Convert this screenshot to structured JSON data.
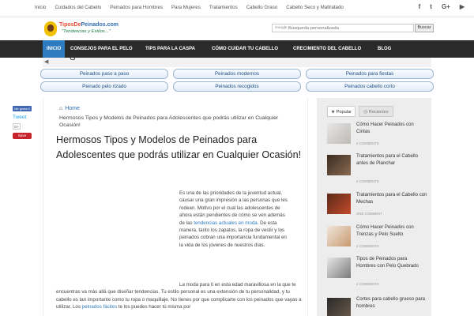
{
  "topbar": {
    "links": [
      "Inicio",
      "Cuidados del Cabello",
      "Peinados para Hombres",
      "Para Mujeres",
      "Tratamientos",
      "Cabello Graso",
      "Cabello Seco y Maltratado"
    ],
    "social": [
      "facebook-icon",
      "twitter-icon",
      "google-plus-icon",
      "youtube-icon"
    ]
  },
  "header": {
    "logo_title_a": "TiposDe",
    "logo_title_b": "Peinados.com",
    "logo_sub": "\"Tendencias y Estilos...\"",
    "search_google": "Google",
    "search_placeholder": "Búsqueda personalizada",
    "search_button": "Buscar"
  },
  "nav": {
    "items": [
      "Inicio",
      "Consejos para el pelo",
      "Tips para la caspa",
      "Cómo cuidar tu cabello",
      "Crecimiento del cabello",
      "Blog"
    ]
  },
  "pills": [
    "Peinados paso a paso",
    "Peinados modernos",
    "Peinados para fiestas",
    "Peinado pelo rizado",
    "Peinados recogidos",
    "Peinados cabello corto"
  ],
  "share": {
    "fb": "Me gusta 0",
    "tw": "Tweet",
    "gp": "G+",
    "save": "Save"
  },
  "article": {
    "crumb_home": "Home",
    "crumb_current": "Hermosos Tipos y Modelos de Peinados para Adolescentes que podrás utilizar en Cualquier Ocasión!",
    "title": "Hermosos Tipos y Modelos de Peinados para Adolescentes que podrás utilizar en Cualquier Ocasión!",
    "p1_a": "Es una de las prioridades de la juventud actual, causar una gran impresión a las personas que les rodean. Motivo por el cual las adolescentes de ahora están pendientes de cómo se ven además de las ",
    "p1_link": "tendencias actuales en moda",
    "p1_b": ". De esta manera, tanto los zapatos, la ropa de vestir y los peinados cobran una importancia fundamental en la vida de los jóvenes de nuestros días.",
    "p2_a": "La moda para ti en esta edad maravillosa en la que te encuentras va más allá que diseñar tendencias. Tu estilo personal es una extensión de tu personalidad, y tu cabello es tan importante como tu ropa o maquillaje. No tienes por que complicarte con los peinados que vayas a utilizar. Los ",
    "p2_link": "peinados fáciles",
    "p2_b": " te los puedes hacer tú misma por"
  },
  "sidebar": {
    "tab_popular": "Popular",
    "tab_recent": "Recientes",
    "posts": [
      {
        "title": "Cómo Hacer Peinados con Cintas",
        "meta": "2 comments"
      },
      {
        "title": "Tratamientos para el Cabello antes de Planchar",
        "meta": "2 comments"
      },
      {
        "title": "Tratamientos para el Cabello con Mechas",
        "meta": "one comment"
      },
      {
        "title": "Cómo Hacer Peinados con Trenzas y Pelo Suelto",
        "meta": "2 comments"
      },
      {
        "title": "Tipos de Peinados para Hombres con Pelo Quebrado",
        "meta": "2 comments"
      },
      {
        "title": "Cortes para cabello grueso para hombres",
        "meta": ""
      }
    ]
  },
  "colors": {
    "nav_bg": "#2b2b2b",
    "nav_active": "#2f7bbf",
    "link": "#2f7bbf"
  }
}
